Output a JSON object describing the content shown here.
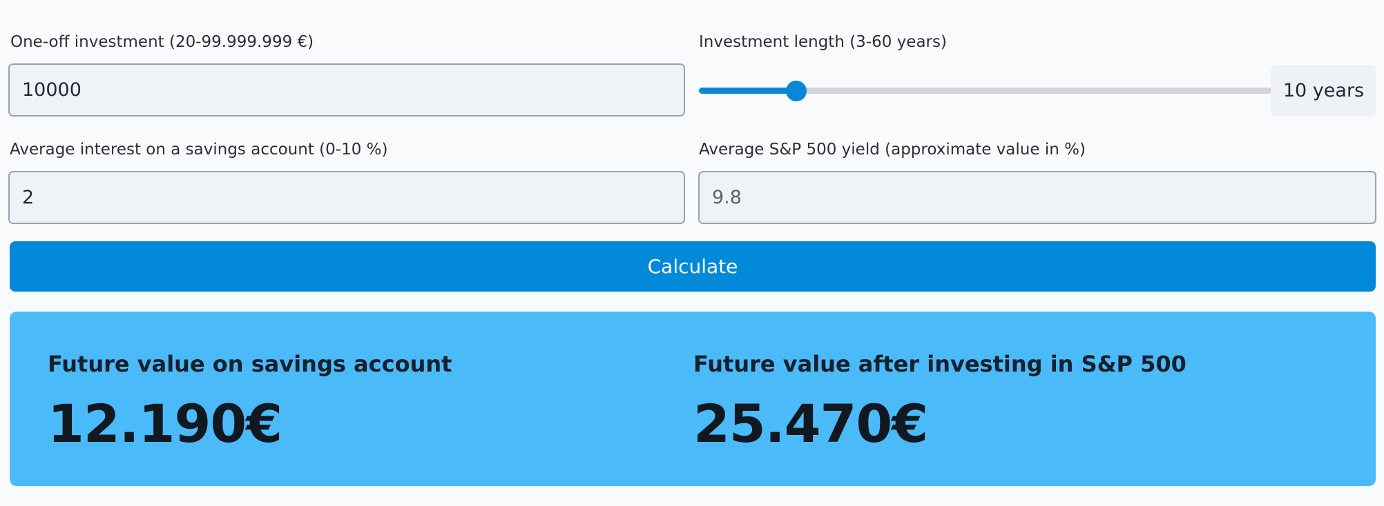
{
  "form": {
    "one_off": {
      "label": "One-off investment (20-99.999.999 €)",
      "value": "10000"
    },
    "length": {
      "label": "Investment length (3-60 years)",
      "min": 3,
      "max": 60,
      "value": 10,
      "display": "10 years"
    },
    "savings_interest": {
      "label": "Average interest on a savings account (0-10 %)",
      "value": "2"
    },
    "sp500_yield": {
      "label": "Average S&P 500 yield (approximate value in %)",
      "value": "9.8"
    },
    "calculate_label": "Calculate"
  },
  "results": {
    "savings": {
      "title": "Future value on savings account",
      "value": "12.190€"
    },
    "sp500": {
      "title": "Future value after investing in S&P 500",
      "value": "25.470€"
    }
  },
  "colors": {
    "accent": "#0389d9",
    "results_bg": "#4bbaf9",
    "input_bg": "#eff2f6"
  }
}
